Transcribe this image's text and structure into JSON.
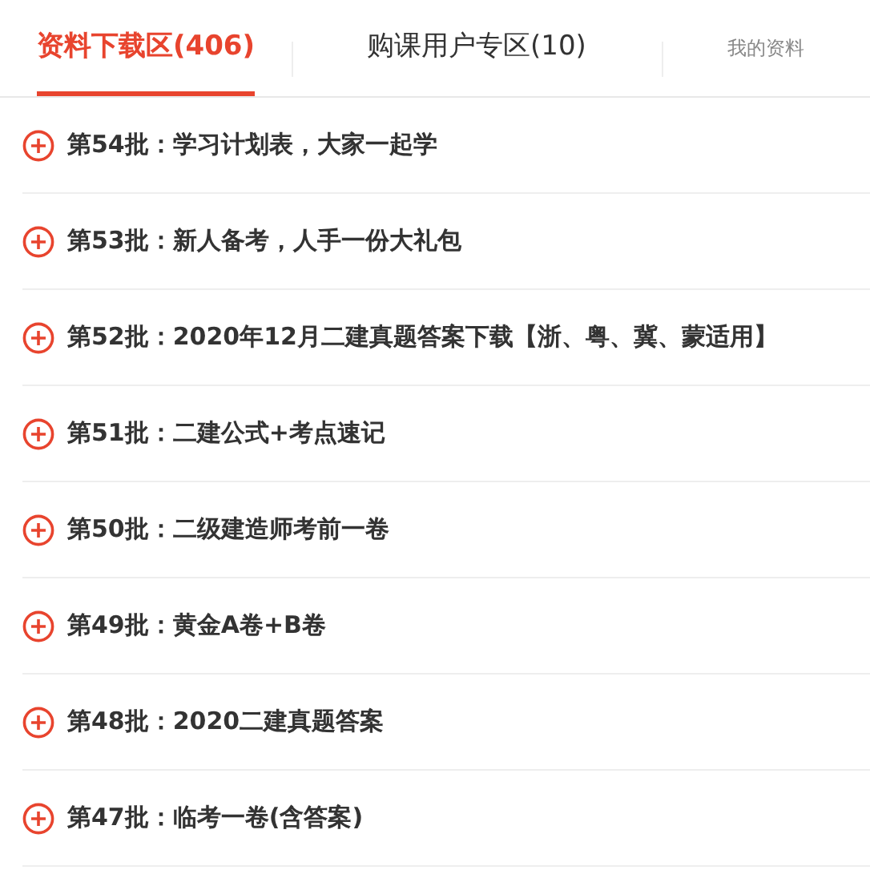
{
  "tabs": [
    {
      "label": "资料下载区(406)",
      "selected": true,
      "kind": "main"
    },
    {
      "label": "购课用户专区(10)",
      "selected": false,
      "kind": "main"
    },
    {
      "label": "我的资料",
      "selected": false,
      "kind": "small"
    }
  ],
  "items": [
    {
      "title": "第54批：学习计划表，大家一起学"
    },
    {
      "title": "第53批：新人备考，人手一份大礼包"
    },
    {
      "title": "第52批：2020年12月二建真题答案下载【浙、粤、冀、蒙适用】"
    },
    {
      "title": "第51批：二建公式+考点速记"
    },
    {
      "title": "第50批：二级建造师考前一卷"
    },
    {
      "title": "第49批：黄金A卷+B卷"
    },
    {
      "title": "第48批：2020二建真题答案"
    },
    {
      "title": "第47批：临考一卷(含答案)"
    }
  ]
}
